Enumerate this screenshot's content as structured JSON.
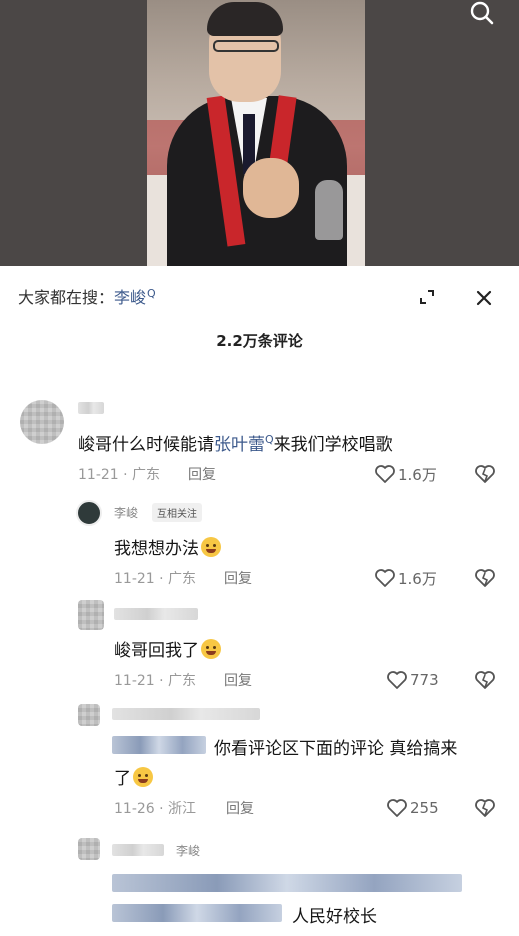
{
  "hot_search": {
    "prefix": "大家都在搜：",
    "keyword": "李峻"
  },
  "comment_count_title": "2.2万条评论",
  "icons": {
    "search": "search-icon",
    "expand": "expand-icon",
    "close": "close-icon",
    "like": "heart-icon",
    "dislike": "broken-heart-icon"
  },
  "colors": {
    "link": "#3d5a8c",
    "meta": "#999999"
  },
  "comments": [
    {
      "body_before": "峻哥什么时候能请",
      "body_link": "张叶蕾",
      "body_after": "来我们学校唱歌",
      "date_location": "11-21 · 广东",
      "reply_label": "回复",
      "likes": "1.6万"
    },
    {
      "author": "李峻",
      "tag": "互相关注",
      "body": "我想想办法",
      "date_location": "11-21 · 广东",
      "reply_label": "回复",
      "likes": "1.6万"
    },
    {
      "body": "峻哥回我了",
      "date_location": "11-21 · 广东",
      "reply_label": "回复",
      "likes": "773"
    },
    {
      "body_line1": "你看评论区下面的评论 真给搞来",
      "body_line2": "了",
      "date_location": "11-26 · 浙江",
      "reply_label": "回复",
      "likes": "255"
    },
    {
      "author": "李峻",
      "body_tail": "人民好校长"
    }
  ]
}
